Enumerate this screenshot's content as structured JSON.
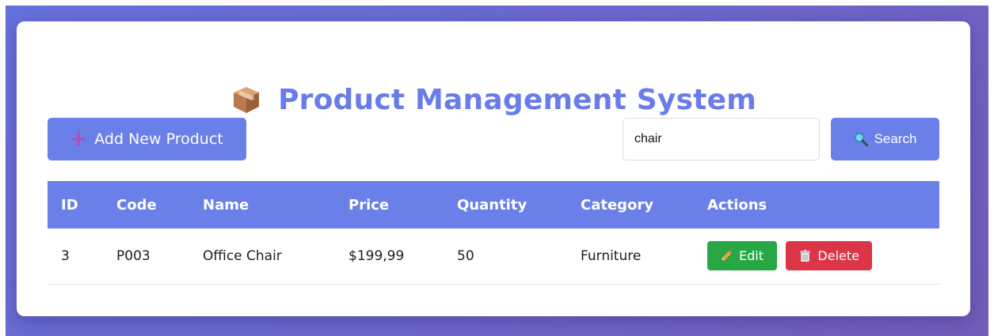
{
  "app": {
    "title": "Product Management System",
    "title_icon": "package-box-icon"
  },
  "toolbar": {
    "add_label": "Add New Product",
    "add_icon": "plus-icon",
    "search_value": "chair",
    "search_label": "Search",
    "search_icon": "magnifier-icon"
  },
  "table": {
    "columns": [
      "ID",
      "Code",
      "Name",
      "Price",
      "Quantity",
      "Category",
      "Actions"
    ],
    "rows": [
      {
        "id": "3",
        "code": "P003",
        "name": "Office Chair",
        "price": "$199,99",
        "quantity": "50",
        "category": "Furniture",
        "edit_label": "Edit",
        "delete_label": "Delete"
      }
    ]
  },
  "colors": {
    "accent": "#6a7fe8",
    "edit": "#28a745",
    "delete": "#dc3545",
    "background_gradient_start": "#6670dc",
    "background_gradient_end": "#745cba"
  }
}
